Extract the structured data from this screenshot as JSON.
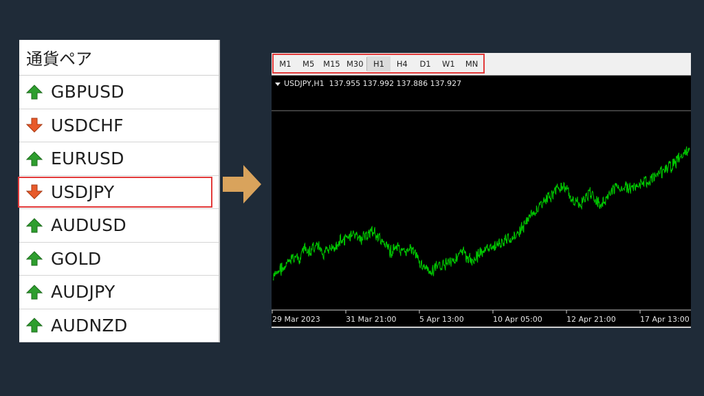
{
  "market_watch": {
    "header": "通貨ペア",
    "items": [
      {
        "symbol": "GBPUSD",
        "direction": "up"
      },
      {
        "symbol": "USDCHF",
        "direction": "down"
      },
      {
        "symbol": "EURUSD",
        "direction": "up"
      },
      {
        "symbol": "USDJPY",
        "direction": "down",
        "selected": true
      },
      {
        "symbol": "AUDUSD",
        "direction": "up"
      },
      {
        "symbol": "GOLD",
        "direction": "up"
      },
      {
        "symbol": "AUDJPY",
        "direction": "up"
      },
      {
        "symbol": "AUDNZD",
        "direction": "up"
      }
    ]
  },
  "timeframes": {
    "items": [
      "M1",
      "M5",
      "M15",
      "M30",
      "H1",
      "H4",
      "D1",
      "W1",
      "MN"
    ],
    "active": "H1"
  },
  "chart": {
    "symbol_label": "USDJPY,H1",
    "open": "137.955",
    "high": "137.992",
    "low": "137.886",
    "close": "137.927",
    "x_ticks": [
      "29 Mar 2023",
      "31 Mar 21:00",
      "5 Apr 13:00",
      "10 Apr 05:00",
      "12 Apr 21:00",
      "17 Apr 13:00"
    ]
  },
  "colors": {
    "background": "#1f2b38",
    "highlight": "#e23a3a",
    "arrow_up": "#2e9e2e",
    "arrow_down": "#e85a2a",
    "big_arrow": "#d9a35c",
    "price_line": "#00c800"
  },
  "chart_data": {
    "type": "line",
    "x": [
      "29 Mar 2023",
      "31 Mar 21:00",
      "5 Apr 13:00",
      "10 Apr 05:00",
      "12 Apr 21:00",
      "17 Apr 13:00"
    ],
    "series": [
      {
        "values": [
          -60,
          -52,
          -50,
          -44,
          -47,
          -40,
          -35,
          -34,
          -30,
          -33,
          -28,
          -20,
          -24,
          -26,
          -22,
          -20,
          -18,
          -24,
          -30,
          -25,
          -22,
          -15,
          -18,
          -14,
          -9,
          -12,
          -8,
          -4,
          -6,
          -2,
          -5,
          -8,
          -6,
          -4,
          -2,
          3,
          0,
          -4,
          -8,
          -12,
          -16,
          -20,
          -24,
          -22,
          -18,
          -23,
          -28,
          -25,
          -22,
          -20,
          -24,
          -30,
          -35,
          -39,
          -44,
          -48,
          -52,
          -50,
          -47,
          -44,
          -42,
          -40,
          -38,
          -36,
          -34,
          -33,
          -31,
          -28,
          -26,
          -30,
          -34,
          -36,
          -32,
          -28,
          -26,
          -24,
          -22,
          -20,
          -22,
          -18,
          -15,
          -14,
          -12,
          -10,
          -7,
          -8,
          -4,
          -2,
          1,
          6,
          10,
          16,
          20,
          24,
          28,
          33,
          36,
          40,
          44,
          47,
          50,
          55,
          58,
          60,
          58,
          53,
          48,
          44,
          40,
          36,
          38,
          42,
          46,
          50,
          48,
          44,
          40,
          36,
          40,
          44,
          48,
          52,
          55,
          57,
          58,
          60,
          57,
          55,
          58,
          60,
          62,
          63,
          64,
          65,
          66,
          68,
          70,
          72,
          74,
          76,
          79,
          82,
          85,
          88,
          91,
          94,
          97,
          100,
          104,
          108
        ]
      }
    ]
  }
}
